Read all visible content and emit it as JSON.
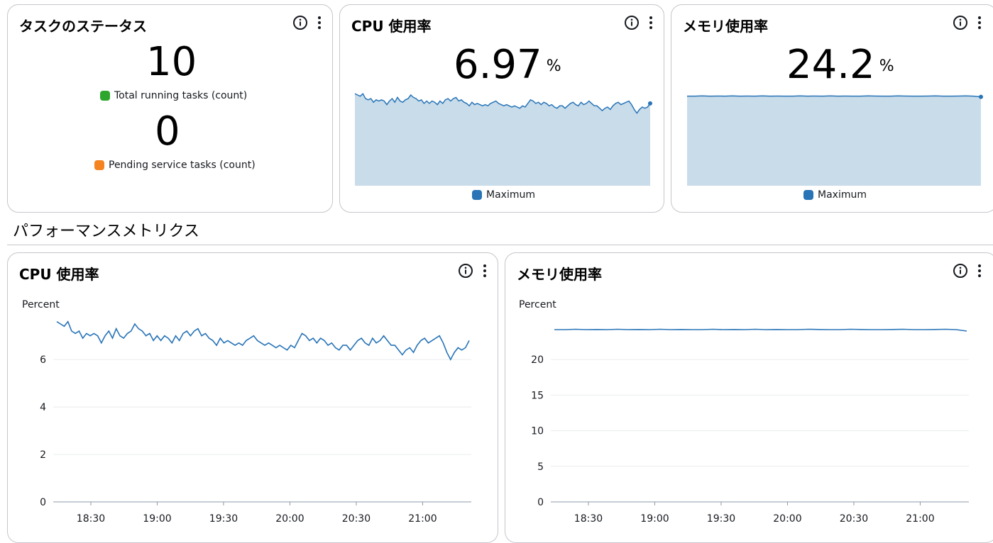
{
  "colors": {
    "series": "#2874b7",
    "fill": "#c9dcea",
    "green": "#2ea62e",
    "orange": "#f58320",
    "grid": "#e9ebed"
  },
  "task_status": {
    "title": "タスクのステータス",
    "running_value": "10",
    "running_label": "Total running tasks (count)",
    "pending_value": "0",
    "pending_label": "Pending service tasks (count)"
  },
  "cpu_card": {
    "title": "CPU 使用率",
    "value": "6.97",
    "unit": "%",
    "legend": "Maximum"
  },
  "mem_card": {
    "title": "メモリ使用率",
    "value": "24.2",
    "unit": "%",
    "legend": "Maximum"
  },
  "section": {
    "title": "パフォーマンスメトリクス"
  },
  "cpu_chart": {
    "title": "CPU 使用率",
    "ylabel": "Percent"
  },
  "mem_chart": {
    "title": "メモリ使用率",
    "ylabel": "Percent"
  },
  "icons": {
    "info": "info-icon",
    "more": "more-vertical-icon"
  },
  "chart_data": [
    {
      "type": "line",
      "ylabel": "Percent",
      "ylim": [
        0,
        7.5
      ],
      "yticks": [
        0,
        2,
        4,
        6
      ],
      "x_ticks": [
        "18:30",
        "19:00",
        "19:30",
        "20:00",
        "20:30",
        "21:00"
      ],
      "x_range": [
        "18:13",
        "21:22"
      ],
      "grid": true,
      "series": [
        {
          "values": [
            7.6,
            7.5,
            7.4,
            7.6,
            7.2,
            7.1,
            7.2,
            6.9,
            7.1,
            7.0,
            7.1,
            7.0,
            6.7,
            7.0,
            7.2,
            6.9,
            7.3,
            7.0,
            6.9,
            7.1,
            7.2,
            7.5,
            7.3,
            7.2,
            7.0,
            7.1,
            6.8,
            7.0,
            6.8,
            7.0,
            6.9,
            6.7,
            7.0,
            6.8,
            7.1,
            7.2,
            7.0,
            7.2,
            7.3,
            7.0,
            7.1,
            6.9,
            6.8,
            6.6,
            6.9,
            6.7,
            6.8,
            6.7,
            6.6,
            6.7,
            6.6,
            6.8,
            6.9,
            7.0,
            6.8,
            6.7,
            6.6,
            6.7,
            6.6,
            6.5,
            6.6,
            6.5,
            6.4,
            6.6,
            6.5,
            6.8,
            7.1,
            7.0,
            6.8,
            6.9,
            6.7,
            6.9,
            6.8,
            6.6,
            6.7,
            6.5,
            6.4,
            6.6,
            6.6,
            6.4,
            6.6,
            6.8,
            6.9,
            6.7,
            6.6,
            6.9,
            6.7,
            6.8,
            7.0,
            6.8,
            6.6,
            6.6,
            6.4,
            6.2,
            6.4,
            6.5,
            6.3,
            6.6,
            6.8,
            6.9,
            6.7,
            6.8,
            6.9,
            7.0,
            6.7,
            6.3,
            6.0,
            6.3,
            6.5,
            6.4,
            6.5,
            6.8
          ]
        }
      ]
    },
    {
      "type": "line",
      "ylabel": "Percent",
      "ylim": [
        0,
        25
      ],
      "yticks": [
        0,
        5,
        10,
        15,
        20
      ],
      "x_ticks": [
        "18:30",
        "19:00",
        "19:30",
        "20:00",
        "20:30",
        "21:00"
      ],
      "x_range": [
        "18:13",
        "21:22"
      ],
      "grid": true,
      "series": [
        {
          "values": [
            24.2,
            24.2,
            24.25,
            24.2,
            24.22,
            24.2,
            24.25,
            24.2,
            24.22,
            24.2,
            24.25,
            24.2,
            24.22,
            24.2,
            24.2,
            24.25,
            24.2,
            24.22,
            24.2,
            24.25,
            24.2,
            24.22,
            24.2,
            24.2,
            24.25,
            24.22,
            24.2,
            24.2,
            24.25,
            24.22,
            24.2,
            24.2,
            24.22,
            24.25,
            24.2,
            24.2,
            24.22,
            24.25,
            24.2,
            24.0
          ]
        }
      ]
    }
  ]
}
